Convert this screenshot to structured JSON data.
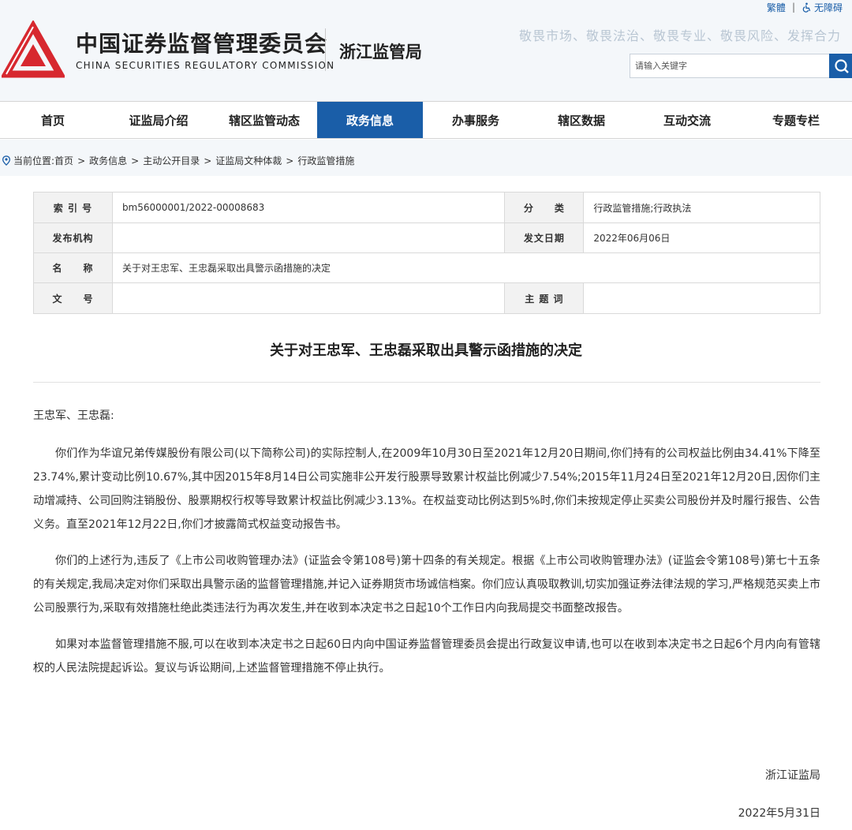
{
  "topbar": {
    "traditional": "繁體",
    "separator": "|",
    "accessible": "无障碍"
  },
  "header": {
    "org_cn": "中国证券监督管理委员会",
    "org_en": "CHINA SECURITIES REGULATORY COMMISSION",
    "bureau": "浙江监管局",
    "slogan": "敬畏市场、敬畏法治、敬畏专业、敬畏风险、发挥合力",
    "logo_color": "#d7282f"
  },
  "search": {
    "placeholder": "请输入关键字"
  },
  "nav": {
    "items": [
      {
        "label": "首页"
      },
      {
        "label": "证监局介绍"
      },
      {
        "label": "辖区监管动态"
      },
      {
        "label": "政务信息",
        "active": true
      },
      {
        "label": "办事服务"
      },
      {
        "label": "辖区数据"
      },
      {
        "label": "互动交流"
      },
      {
        "label": "专题专栏"
      }
    ],
    "active_color": "#1a5ea8"
  },
  "breadcrumb": {
    "prefix": "当前位置:",
    "items": [
      "首页",
      "政务信息",
      "主动公开目录",
      "证监局文种体裁",
      "行政监管措施"
    ],
    "sep": ">"
  },
  "info": {
    "index_label": "索 引 号",
    "index_value": "bm56000001/2022-00008683",
    "category_label": "分　　类",
    "category_value": "行政监管措施;行政执法",
    "issuer_label": "发布机构",
    "issuer_value": "",
    "date_label": "发文日期",
    "date_value": "2022年06月06日",
    "name_label": "名　　称",
    "name_value": "关于对王忠军、王忠磊采取出具警示函措施的决定",
    "docno_label": "文　　号",
    "docno_value": "",
    "keywords_label": "主 题 词",
    "keywords_value": ""
  },
  "article": {
    "title": "关于对王忠军、王忠磊采取出具警示函措施的决定",
    "greeting": "王忠军、王忠磊:",
    "paragraphs": [
      "你们作为华谊兄弟传媒股份有限公司(以下简称公司)的实际控制人,在2009年10月30日至2021年12月20日期间,你们持有的公司权益比例由34.41%下降至23.74%,累计变动比例10.67%,其中因2015年8月14日公司实施非公开发行股票导致累计权益比例减少7.54%;2015年11月24日至2021年12月20日,因你们主动增减持、公司回购注销股份、股票期权行权等导致累计权益比例减少3.13%。在权益变动比例达到5%时,你们未按规定停止买卖公司股份并及时履行报告、公告义务。直至2021年12月22日,你们才披露简式权益变动报告书。",
      "你们的上述行为,违反了《上市公司收购管理办法》(证监会令第108号)第十四条的有关规定。根据《上市公司收购管理办法》(证监会令第108号)第七十五条的有关规定,我局决定对你们采取出具警示函的监督管理措施,并记入证券期货市场诚信档案。你们应认真吸取教训,切实加强证券法律法规的学习,严格规范买卖上市公司股票行为,采取有效措施杜绝此类违法行为再次发生,并在收到本决定书之日起10个工作日内向我局提交书面整改报告。",
      "如果对本监督管理措施不服,可以在收到本决定书之日起60日内向中国证券监督管理委员会提出行政复议申请,也可以在收到本决定书之日起6个月内向有管辖权的人民法院提起诉讼。复议与诉讼期间,上述监督管理措施不停止执行。"
    ],
    "signature": "浙江证监局",
    "date": "2022年5月31日"
  }
}
